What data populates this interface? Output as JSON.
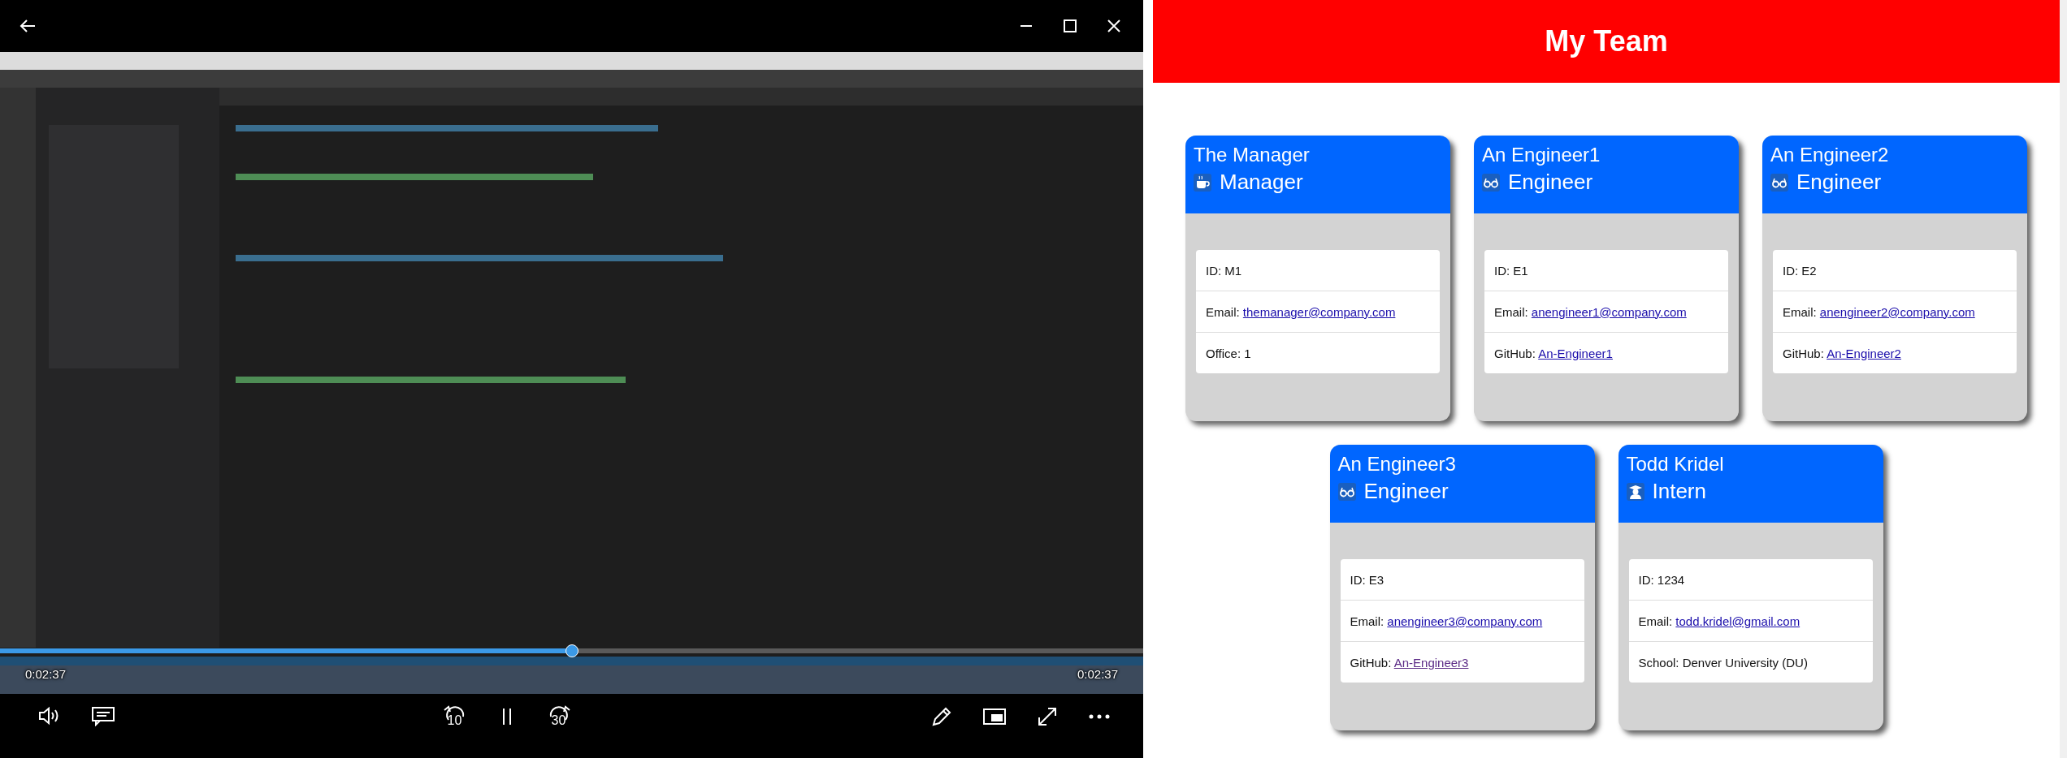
{
  "player": {
    "seek": {
      "level": 0.5
    },
    "elapsed": "0:02:37",
    "remaining": "0:02:37",
    "playing": true,
    "replay_label": "10",
    "forward_label": "30"
  },
  "page": {
    "title": "My Team",
    "employees": [
      {
        "name": "The Manager",
        "role": "Manager",
        "kind": "manager",
        "details": [
          {
            "label": "ID:",
            "value": "M1",
            "kind": "text"
          },
          {
            "label": "Email:",
            "value": "themanager@company.com",
            "kind": "link",
            "visited": false
          },
          {
            "label": "Office:",
            "value": "1",
            "kind": "text"
          }
        ]
      },
      {
        "name": "An Engineer1",
        "role": "Engineer",
        "kind": "engineer",
        "details": [
          {
            "label": "ID:",
            "value": "E1",
            "kind": "text"
          },
          {
            "label": "Email:",
            "value": "anengineer1@company.com",
            "kind": "link",
            "visited": false
          },
          {
            "label": "GitHub:",
            "value": "An-Engineer1",
            "kind": "link",
            "visited": false
          }
        ]
      },
      {
        "name": "An Engineer2",
        "role": "Engineer",
        "kind": "engineer",
        "details": [
          {
            "label": "ID:",
            "value": "E2",
            "kind": "text"
          },
          {
            "label": "Email:",
            "value": "anengineer2@company.com",
            "kind": "link",
            "visited": false
          },
          {
            "label": "GitHub:",
            "value": "An-Engineer2",
            "kind": "link",
            "visited": false
          }
        ]
      },
      {
        "name": "An Engineer3",
        "role": "Engineer",
        "kind": "engineer",
        "details": [
          {
            "label": "ID:",
            "value": "E3",
            "kind": "text"
          },
          {
            "label": "Email:",
            "value": "anengineer3@company.com",
            "kind": "link",
            "visited": false
          },
          {
            "label": "GitHub:",
            "value": "An-Engineer3",
            "kind": "link",
            "visited": true
          }
        ]
      },
      {
        "name": "Todd Kridel",
        "role": "Intern",
        "kind": "intern",
        "details": [
          {
            "label": "ID:",
            "value": "1234",
            "kind": "text"
          },
          {
            "label": "Email:",
            "value": "todd.kridel@gmail.com",
            "kind": "link",
            "visited": false
          },
          {
            "label": "School:",
            "value": "Denver University (DU)",
            "kind": "text"
          }
        ]
      }
    ]
  }
}
